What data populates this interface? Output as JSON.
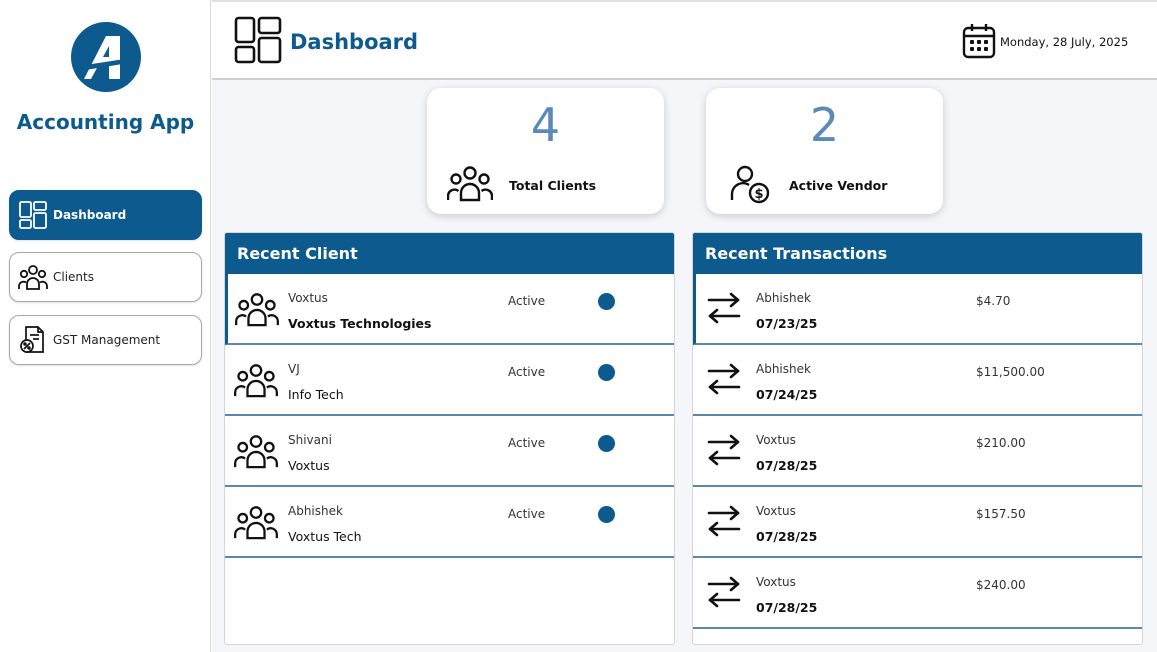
{
  "app": {
    "title": "Accounting App",
    "brand_color": "#0d5a8f"
  },
  "sidebar": {
    "items": [
      {
        "label": "Dashboard",
        "icon": "dashboard-icon",
        "active": true
      },
      {
        "label": "Clients",
        "icon": "clients-icon",
        "active": false
      },
      {
        "label": "GST Management",
        "icon": "gst-document-icon",
        "active": false
      }
    ]
  },
  "header": {
    "title": "Dashboard",
    "date": "Monday, 28 July, 2025"
  },
  "stats": [
    {
      "value": "4",
      "label": "Total Clients",
      "icon": "clients-icon"
    },
    {
      "value": "2",
      "label": "Active Vendor",
      "icon": "vendor-icon"
    }
  ],
  "recent_clients": {
    "title": "Recent Client",
    "rows": [
      {
        "name": "Voxtus",
        "company": "Voxtus Technologies",
        "status": "Active"
      },
      {
        "name": "VJ",
        "company": "Info Tech",
        "status": "Active"
      },
      {
        "name": "Shivani",
        "company": "Voxtus",
        "status": "Active"
      },
      {
        "name": "Abhishek",
        "company": "Voxtus Tech",
        "status": "Active"
      }
    ]
  },
  "recent_transactions": {
    "title": "Recent Transactions",
    "rows": [
      {
        "name": "Abhishek",
        "date": "07/23/25",
        "amount": "$4.70"
      },
      {
        "name": "Abhishek",
        "date": "07/24/25",
        "amount": "$11,500.00"
      },
      {
        "name": "Voxtus",
        "date": "07/28/25",
        "amount": "$210.00"
      },
      {
        "name": "Voxtus",
        "date": "07/28/25",
        "amount": "$157.50"
      },
      {
        "name": "Voxtus",
        "date": "07/28/25",
        "amount": "$240.00"
      }
    ]
  }
}
